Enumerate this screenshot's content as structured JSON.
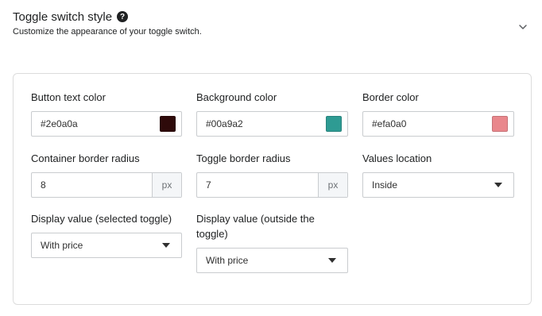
{
  "header": {
    "title": "Toggle switch style",
    "help_icon": "question-circle-icon",
    "subtitle": "Customize the appearance of your toggle switch.",
    "collapse_icon": "chevron-down-icon"
  },
  "fields": {
    "button_text_color": {
      "label": "Button text color",
      "value": "#2e0a0a",
      "swatch": "#2e0a0a"
    },
    "background_color": {
      "label": "Background color",
      "value": "#00a9a2",
      "swatch": "#2e9b93"
    },
    "border_color": {
      "label": "Border color",
      "value": "#efa0a0",
      "swatch": "#e9878c"
    },
    "container_border_radius": {
      "label": "Container border radius",
      "value": "8",
      "unit": "px"
    },
    "toggle_border_radius": {
      "label": "Toggle border radius",
      "value": "7",
      "unit": "px"
    },
    "values_location": {
      "label": "Values location",
      "selected": "Inside"
    },
    "display_value_selected": {
      "label": "Display value (selected toggle)",
      "selected": "With price"
    },
    "display_value_outside": {
      "label_line1": "Display value (outside the",
      "label_line2": "toggle)",
      "selected": "With price"
    }
  }
}
